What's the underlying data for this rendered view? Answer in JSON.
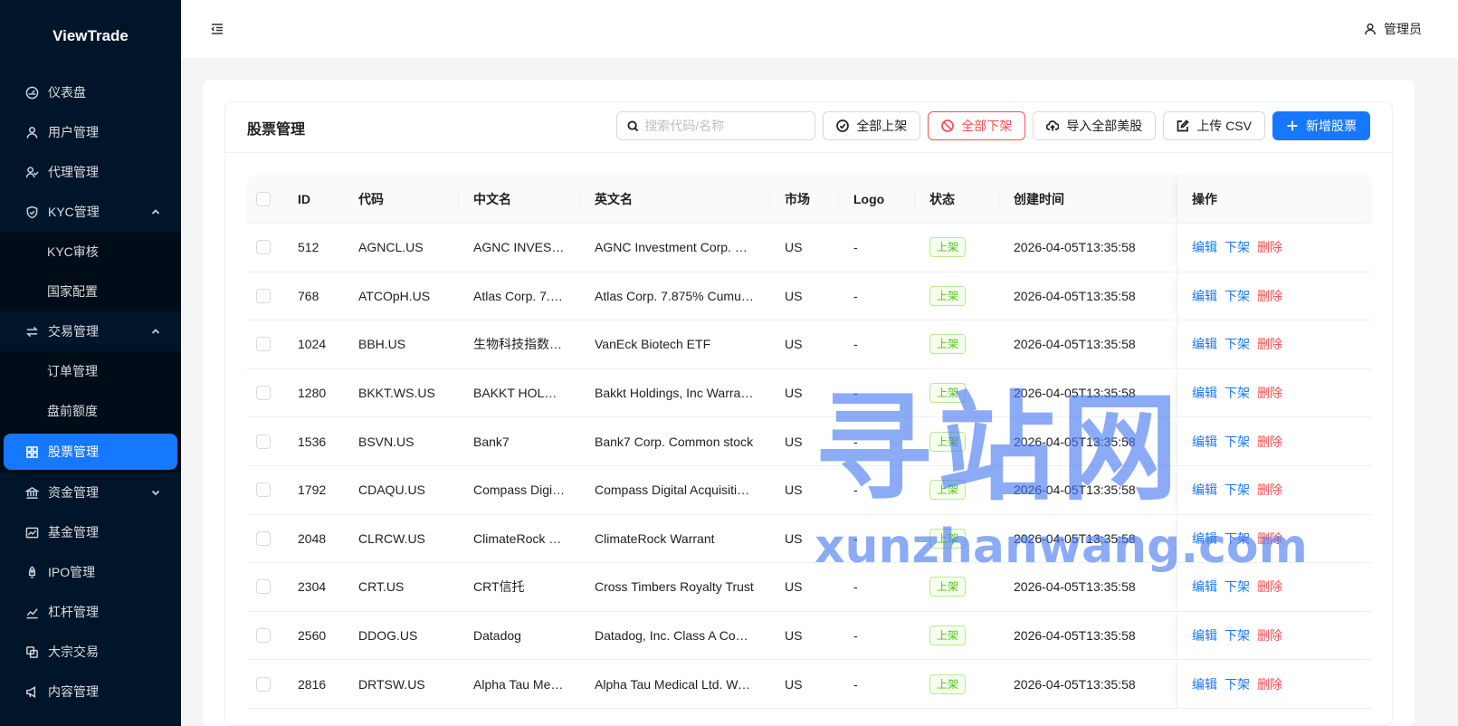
{
  "sidebar": {
    "logo": "ViewTrade",
    "items": [
      {
        "label": "仪表盘",
        "icon": "dashboard-icon"
      },
      {
        "label": "用户管理",
        "icon": "user-icon"
      },
      {
        "label": "代理管理",
        "icon": "team-icon"
      },
      {
        "label": "KYC管理",
        "icon": "shield-icon",
        "expanded": true
      },
      {
        "label": "KYC审核"
      },
      {
        "label": "国家配置"
      },
      {
        "label": "交易管理",
        "icon": "swap-icon",
        "expanded": true
      },
      {
        "label": "订单管理"
      },
      {
        "label": "盘前额度"
      },
      {
        "label": "股票管理",
        "icon": "appstore-icon",
        "active": true
      },
      {
        "label": "资金管理",
        "icon": "bank-icon",
        "expanded": false
      },
      {
        "label": "基金管理",
        "icon": "fund-icon"
      },
      {
        "label": "IPO管理",
        "icon": "rocket-icon"
      },
      {
        "label": "杠杆管理",
        "icon": "stock-icon"
      },
      {
        "label": "大宗交易",
        "icon": "block-icon"
      },
      {
        "label": "内容管理",
        "icon": "notification-icon"
      }
    ]
  },
  "header": {
    "user": "管理员"
  },
  "card": {
    "title": "股票管理",
    "search_placeholder": "搜索代码/名称",
    "buttons": {
      "list_all": "全部上架",
      "delist_all": "全部下架",
      "import_us": "导入全部美股",
      "upload_csv": "上传 CSV",
      "add": "新增股票"
    }
  },
  "table": {
    "columns": [
      "ID",
      "代码",
      "中文名",
      "英文名",
      "市场",
      "Logo",
      "状态",
      "创建时间",
      "操作"
    ],
    "actions": {
      "edit": "编辑",
      "delist": "下架",
      "delete": "删除"
    },
    "rows": [
      {
        "id": "512",
        "code": "AGNCL.US",
        "cn": "AGNC INVEST...",
        "en": "AGNC Investment Corp. De...",
        "market": "US",
        "logo": "-",
        "status": "上架",
        "created": "2026-04-05T13:35:58"
      },
      {
        "id": "768",
        "code": "ATCOpH.US",
        "cn": "Atlas Corp. 7.8...",
        "en": "Atlas Corp. 7.875% Cumulat...",
        "market": "US",
        "logo": "-",
        "status": "上架",
        "created": "2026-04-05T13:35:58"
      },
      {
        "id": "1024",
        "code": "BBH.US",
        "cn": "生物科技指数E...",
        "en": "VanEck Biotech ETF",
        "market": "US",
        "logo": "-",
        "status": "上架",
        "created": "2026-04-05T13:35:58"
      },
      {
        "id": "1280",
        "code": "BKKT.WS.US",
        "cn": "BAKKT HOLDIN...",
        "en": "Bakkt Holdings, Inc Warrant...",
        "market": "US",
        "logo": "-",
        "status": "上架",
        "created": "2026-04-05T13:35:58"
      },
      {
        "id": "1536",
        "code": "BSVN.US",
        "cn": "Bank7",
        "en": "Bank7 Corp. Common stock",
        "market": "US",
        "logo": "-",
        "status": "上架",
        "created": "2026-04-05T13:35:58"
      },
      {
        "id": "1792",
        "code": "CDAQU.US",
        "cn": "Compass Digit...",
        "en": "Compass Digital Acquisition...",
        "market": "US",
        "logo": "-",
        "status": "上架",
        "created": "2026-04-05T13:35:58"
      },
      {
        "id": "2048",
        "code": "CLRCW.US",
        "cn": "ClimateRock W...",
        "en": "ClimateRock Warrant",
        "market": "US",
        "logo": "-",
        "status": "上架",
        "created": "2026-04-05T13:35:58"
      },
      {
        "id": "2304",
        "code": "CRT.US",
        "cn": "CRT信托",
        "en": "Cross Timbers Royalty Trust",
        "market": "US",
        "logo": "-",
        "status": "上架",
        "created": "2026-04-05T13:35:58"
      },
      {
        "id": "2560",
        "code": "DDOG.US",
        "cn": "Datadog",
        "en": "Datadog, Inc. Class A Com...",
        "market": "US",
        "logo": "-",
        "status": "上架",
        "created": "2026-04-05T13:35:58"
      },
      {
        "id": "2816",
        "code": "DRTSW.US",
        "cn": "Alpha Tau Medi...",
        "en": "Alpha Tau Medical Ltd. Warr...",
        "market": "US",
        "logo": "-",
        "status": "上架",
        "created": "2026-04-05T13:35:58"
      }
    ]
  },
  "watermark": {
    "big": "寻站网",
    "small": "xunzhanwang.com"
  }
}
